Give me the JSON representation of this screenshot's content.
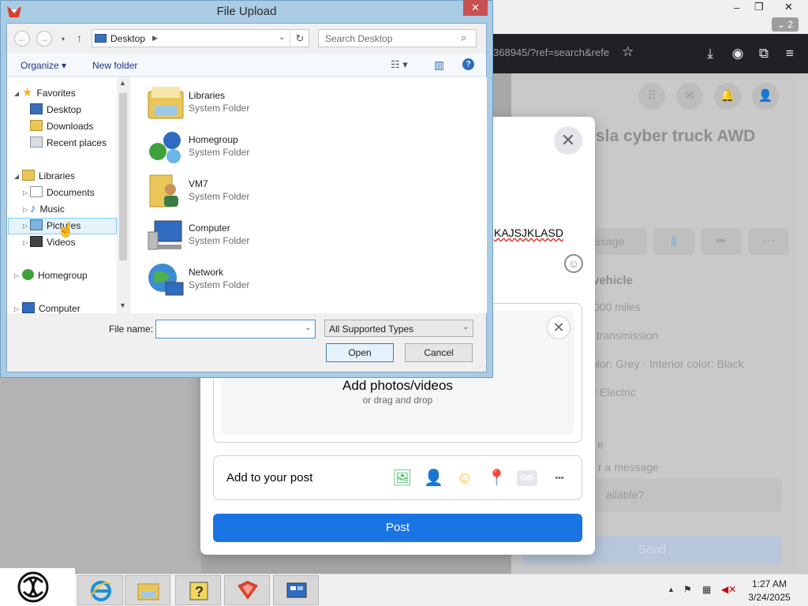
{
  "browser": {
    "url_fragment": "368945/?ref=search&refe",
    "tab_count_label": "⌄ 2",
    "window_buttons": [
      "–",
      "❐",
      "✕"
    ]
  },
  "listing": {
    "title_fragment": "sla cyber truck AWD",
    "message_partial": "ssage",
    "section": "vehicle",
    "mileage": "000 miles",
    "transmission": "c transmission",
    "colors": "olor: Grey · Interior color: Black",
    "fuel": "c Electric",
    "seller_partial": "e",
    "message_prompt": "r a message",
    "available_question": "ailable?",
    "send_label": "Send"
  },
  "post_modal": {
    "close_glyph": "✕",
    "text_tail": "KAJSJKLASD",
    "upload_title": "Add photos/videos",
    "upload_sub": "or drag and drop",
    "add_to_post": "Add to your post",
    "post_label": "Post",
    "gif_label": "GIF",
    "more_glyph": "•••"
  },
  "dialog": {
    "title": "File Upload",
    "address": "Desktop",
    "search_placeholder": "Search Desktop",
    "organize": "Organize ▾",
    "new_folder": "New folder",
    "nav": {
      "favorites": "Favorites",
      "desktop": "Desktop",
      "downloads": "Downloads",
      "recent": "Recent places",
      "libraries": "Libraries",
      "documents": "Documents",
      "music": "Music",
      "pictures": "Pictures",
      "videos": "Videos",
      "homegroup": "Homegroup",
      "computer": "Computer"
    },
    "files": [
      {
        "name": "Libraries",
        "type": "System Folder"
      },
      {
        "name": "Homegroup",
        "type": "System Folder"
      },
      {
        "name": "VM7",
        "type": "System Folder"
      },
      {
        "name": "Computer",
        "type": "System Folder"
      },
      {
        "name": "Network",
        "type": "System Folder"
      }
    ],
    "file_name_label": "File name:",
    "file_name_value": "",
    "file_type": "All Supported Types",
    "open_label": "Open",
    "cancel_label": "Cancel"
  },
  "taskbar": {
    "time": "1:27 AM",
    "date": "3/24/2025"
  }
}
